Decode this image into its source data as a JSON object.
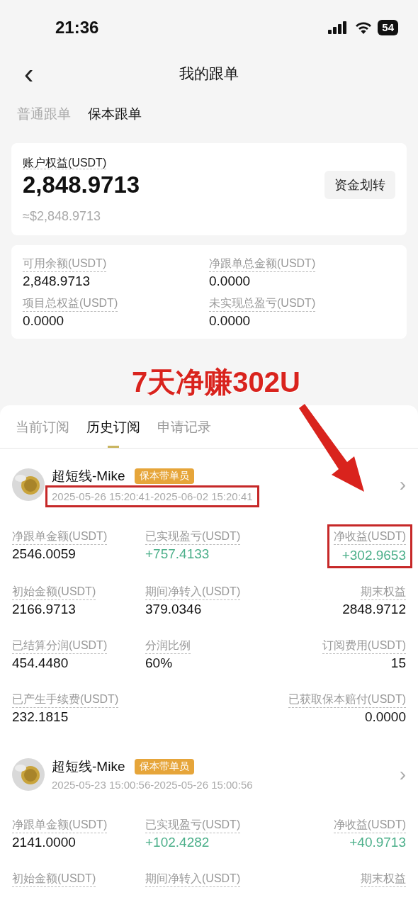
{
  "status_bar": {
    "time": "21:36",
    "battery": "54"
  },
  "nav": {
    "back": "‹",
    "title": "我的跟单"
  },
  "mode_tabs": [
    {
      "label": "普通跟单",
      "selected": false
    },
    {
      "label": "保本跟单",
      "selected": true
    }
  ],
  "equity_card": {
    "label": "账户权益(USDT)",
    "value": "2,848.9713",
    "approx": "≈$2,848.9713",
    "button": "资金划转"
  },
  "summary": [
    {
      "label": "可用余额(USDT)",
      "value": "2,848.9713"
    },
    {
      "label": "净跟单总金额(USDT)",
      "value": "0.0000"
    },
    {
      "label": "项目总权益(USDT)",
      "value": "0.0000"
    },
    {
      "label": "未实现总盈亏(USDT)",
      "value": "0.0000"
    }
  ],
  "annotation": {
    "text": "7天净赚302U"
  },
  "record_tabs": [
    {
      "label": "当前订阅",
      "selected": false
    },
    {
      "label": "历史订阅",
      "selected": true
    },
    {
      "label": "申请记录",
      "selected": false
    }
  ],
  "records": [
    {
      "name": "超短线-Mike",
      "badge": "保本带单员",
      "period": "2025-05-26 15:20:41-2025-06-02 15:20:41",
      "period_highlighted": true,
      "chevron": "›",
      "rows": [
        {
          "left": {
            "label": "净跟单金额(USDT)",
            "value": "2546.0059",
            "kind": "plain",
            "highlighted": false
          },
          "middle": {
            "label": "已实现盈亏(USDT)",
            "value": "+757.4133",
            "kind": "gain",
            "highlighted": false
          },
          "right": {
            "label": "净收益(USDT)",
            "value": "+302.9653",
            "kind": "gain",
            "highlighted": true
          }
        },
        {
          "left": {
            "label": "初始金额(USDT)",
            "value": "2166.9713",
            "kind": "plain",
            "highlighted": false
          },
          "middle": {
            "label": "期间净转入(USDT)",
            "value": "379.0346",
            "kind": "plain",
            "highlighted": false
          },
          "right": {
            "label": "期末权益",
            "value": "2848.9712",
            "kind": "plain",
            "highlighted": false
          }
        },
        {
          "left": {
            "label": "已结算分润(USDT)",
            "value": "454.4480",
            "kind": "plain",
            "highlighted": false
          },
          "middle": {
            "label": "分润比例",
            "value": "60%",
            "kind": "plain",
            "highlighted": false
          },
          "right": {
            "label": "订阅费用(USDT)",
            "value": "15",
            "kind": "plain",
            "highlighted": false
          }
        },
        {
          "left": {
            "label": "已产生手续费(USDT)",
            "value": "232.1815",
            "kind": "plain",
            "highlighted": false
          },
          "right": {
            "label": "已获取保本赔付(USDT)",
            "value": "0.0000",
            "kind": "plain",
            "highlighted": false
          }
        }
      ]
    },
    {
      "name": "超短线-Mike",
      "badge": "保本带单员",
      "period": "2025-05-23 15:00:56-2025-05-26 15:00:56",
      "period_highlighted": false,
      "chevron": "›",
      "rows": [
        {
          "left": {
            "label": "净跟单金额(USDT)",
            "value": "2141.0000",
            "kind": "plain",
            "highlighted": false
          },
          "middle": {
            "label": "已实现盈亏(USDT)",
            "value": "+102.4282",
            "kind": "gain",
            "highlighted": false
          },
          "right": {
            "label": "净收益(USDT)",
            "value": "+40.9713",
            "kind": "gain",
            "highlighted": false
          }
        },
        {
          "left": {
            "label": "初始金额(USDT)",
            "highlighted": false
          },
          "middle": {
            "label": "期间净转入(USDT)",
            "highlighted": false
          },
          "right": {
            "label": "期末权益",
            "highlighted": false
          }
        }
      ]
    }
  ]
}
